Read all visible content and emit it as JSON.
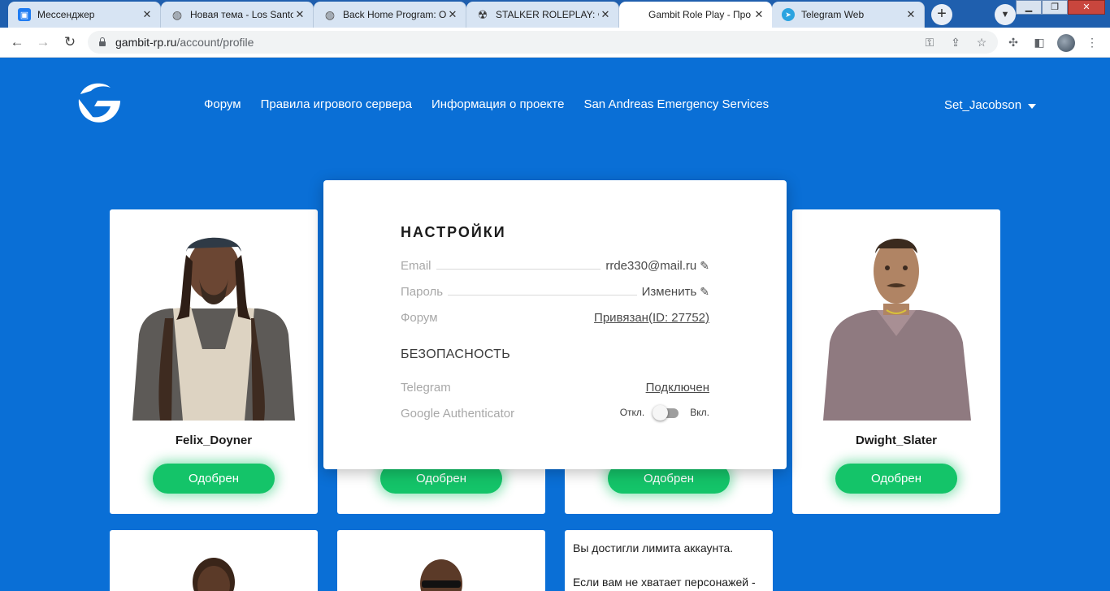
{
  "browser": {
    "tabs": [
      {
        "title": "Мессенджер",
        "icon": "messenger-icon"
      },
      {
        "title": "Новая тема - Los Santos",
        "icon": "globe-icon"
      },
      {
        "title": "Back Home Program: О",
        "icon": "globe-icon"
      },
      {
        "title": "STALKER ROLEPLAY: Фо",
        "icon": "radiation-icon"
      },
      {
        "title": "Gambit Role Play - Про",
        "icon": "gambit-icon"
      },
      {
        "title": "Telegram Web",
        "icon": "telegram-icon"
      }
    ],
    "url_host": "gambit-rp.ru",
    "url_path": "/account/profile"
  },
  "site": {
    "nav": [
      "Форум",
      "Правила игрового сервера",
      "Информация о проекте",
      "San Andreas Emergency Services"
    ],
    "user": "Set_Jacobson"
  },
  "characters": [
    {
      "name": "Felix_Doyner",
      "status": "Одобрен"
    },
    {
      "name": "",
      "status": "Одобрен"
    },
    {
      "name": "",
      "status": "Одобрен"
    },
    {
      "name": "Dwight_Slater",
      "status": "Одобрен"
    }
  ],
  "limit_card": {
    "line1": "Вы достигли лимита аккаунта.",
    "line2": "Если вам не хватает персонажей -"
  },
  "settings": {
    "title": "НАСТРОЙКИ",
    "email_label": "Email",
    "email_value": "rrde330@mail.ru",
    "password_label": "Пароль",
    "password_value": "Изменить",
    "forum_label": "Форум",
    "forum_value": "Привязан(ID: 27752)",
    "security_title": "БЕЗОПАСНОСТЬ",
    "telegram_label": "Telegram",
    "telegram_value": "Подключен",
    "ga_label": "Google Authenticator",
    "ga_off": "Откл.",
    "ga_on": "Вкл.",
    "ga_enabled": false
  },
  "colors": {
    "page_bg": "#0a6fd6",
    "status_green": "#14c469"
  }
}
